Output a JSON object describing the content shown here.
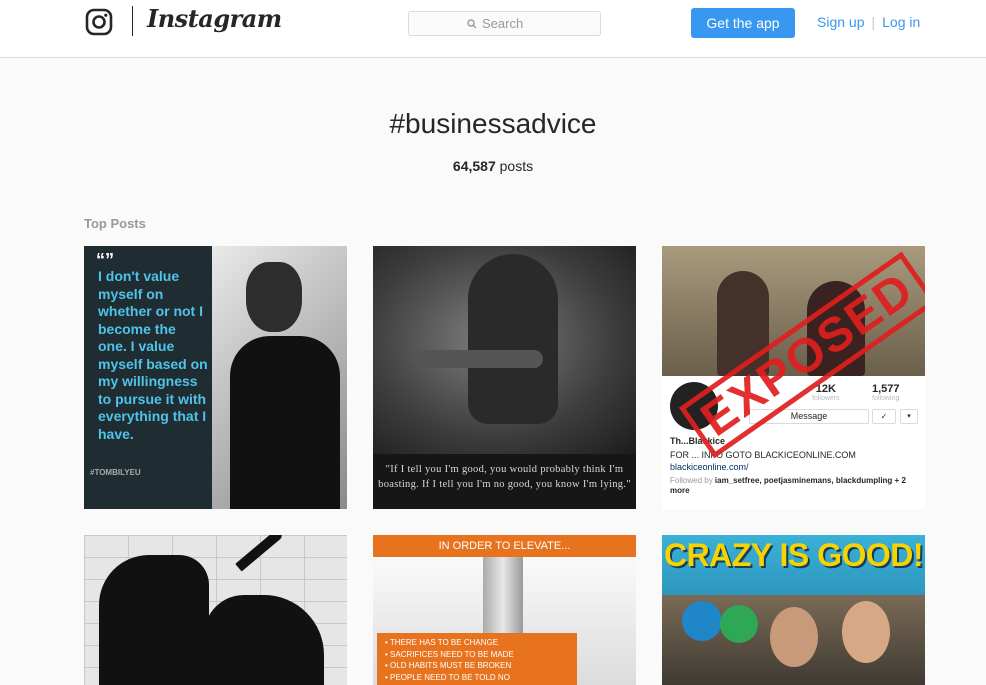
{
  "header": {
    "brand": "Instagram",
    "search_placeholder": "Search",
    "get_app_label": "Get the app",
    "signup_label": "Sign up",
    "separator": "|",
    "login_label": "Log in"
  },
  "hashtag": {
    "title": "#businessadvice",
    "post_count": "64,587",
    "post_count_suffix": "posts"
  },
  "top_posts_label": "Top Posts",
  "posts": [
    {
      "quote_mark": "“”",
      "quote_text": "I don't value myself on whether or not I become the one. I value myself based on my willingness to pursue it with everything that I have.",
      "handle": "#TOMBILYEU"
    },
    {
      "caption": "\"If I tell you I'm good, you would probably think I'm boasting. If I tell you I'm no good, you know I'm lying.\""
    },
    {
      "followers_count": "12K",
      "followers_label": "followers",
      "following_count": "1,577",
      "following_label": "following",
      "message_label": "Message",
      "follow_icon": "✓",
      "more_icon": "▾",
      "name": "Th...Blackice",
      "bio": "FOR ... INFO GOTO BLACKICEONLINE.COM",
      "link": "blackiceonline.com/",
      "followed_prefix": "Followed by",
      "followed_names": "iam_setfree, poetjasminemans, blackdumpling",
      "followed_more": "+ 2 more",
      "stamp": "EXPOSED"
    },
    {},
    {
      "banner": "IN ORDER TO ELEVATE...",
      "list_items": [
        "• THERE HAS TO BE CHANGE",
        "• SACRIFICES NEED TO BE MADE",
        "• OLD HABITS MUST BE BROKEN",
        "• PEOPLE NEED TO BE TOLD NO"
      ]
    },
    {
      "title": "CRAZY IS GOOD!"
    }
  ],
  "colors": {
    "accent": "#3897f0",
    "quote_cyan": "#4fc3e8",
    "stamp_red": "#e01e1e",
    "banner_orange": "#e8731f",
    "title_yellow": "#f5d400"
  }
}
